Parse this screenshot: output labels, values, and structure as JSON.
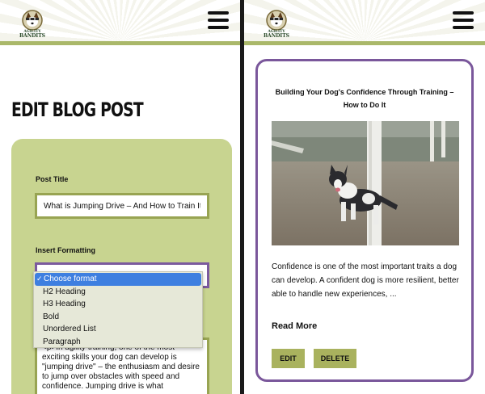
{
  "brand": {
    "logo_alt": "Agility Bandits",
    "logo_text_top": "AGILITY",
    "logo_text_bottom": "BANDITS",
    "accent_color": "#aab86a",
    "card_border_color": "#7a579b"
  },
  "header": {
    "menu_icon": "hamburger-menu-icon"
  },
  "edit_page": {
    "title": "EDIT BLOG POST",
    "post_title_label": "Post Title",
    "post_title_value": "What is Jumping Drive – And How to Train It",
    "formatting_label": "Insert Formatting",
    "format_options": [
      "Choose format",
      "H2 Heading",
      "H3 Heading",
      "Bold",
      "Unordered List",
      "Paragraph"
    ],
    "selected_format": "Choose format",
    "content_value": "<p>In agility training, one of the most exciting skills your dog can develop is \"jumping drive\" – the enthusiasm and desire to jump over obstacles with speed and confidence. Jumping drive is what"
  },
  "blog_card": {
    "title": "Building Your Dog's Confidence Through Training – How to Do It",
    "image_alt": "Dog running through weave poles",
    "excerpt": "Confidence is one of the most important traits a dog can develop. A confident dog is more resilient, better able to handle new experiences, ...",
    "read_more": "Read More",
    "edit_label": "EDIT",
    "delete_label": "DELETE"
  }
}
